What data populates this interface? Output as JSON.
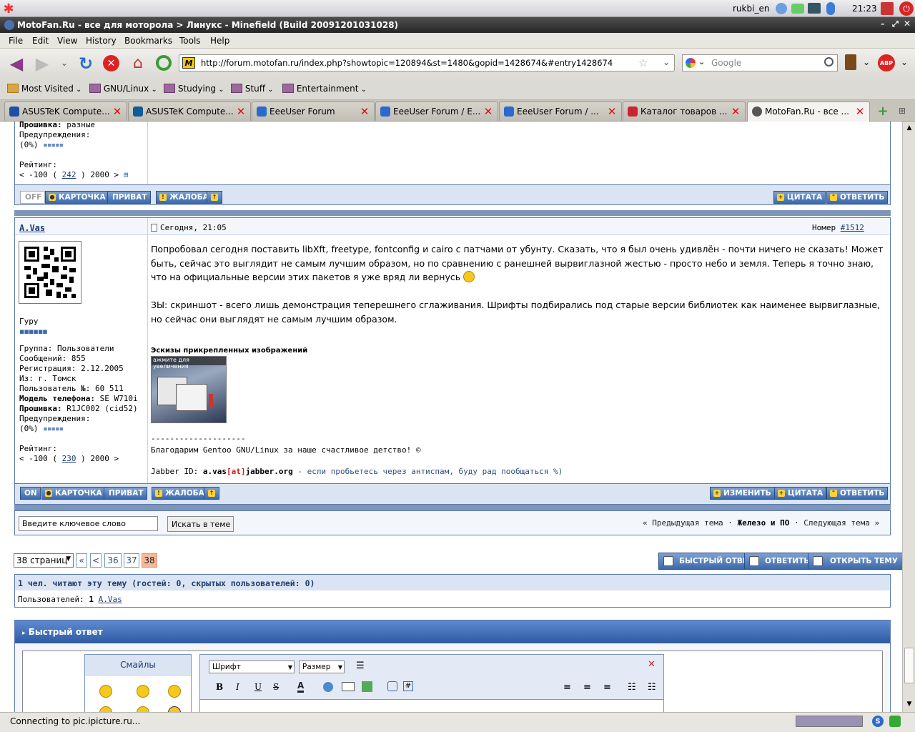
{
  "top_panel": {
    "user": "rukbi_en",
    "time": "21:23"
  },
  "window": {
    "title": "MotoFan.Ru - все для моторола > Линукс - Minefield (Build 20091201031028)"
  },
  "menu": [
    "File",
    "Edit",
    "View",
    "History",
    "Bookmarks",
    "Tools",
    "Help"
  ],
  "nav": {
    "url": "http://forum.motofan.ru/index.php?showtopic=120894&st=1480&gopid=1428674&#entry1428674",
    "search_placeholder": "Google"
  },
  "bookmarks": [
    "Most Visited",
    "GNU/Linux",
    "Studying",
    "Stuff",
    "Entertainment"
  ],
  "tabs": [
    {
      "label": "ASUSTeK Compute...",
      "color": "#1e4fa5"
    },
    {
      "label": "ASUSTeK Compute...",
      "color": "#0f5c99"
    },
    {
      "label": "EeeUser Forum",
      "color": "#2a6acd"
    },
    {
      "label": "EeeUser Forum / E...",
      "color": "#2a6acd"
    },
    {
      "label": "EeeUser Forum / ...",
      "color": "#2a6acd"
    },
    {
      "label": "Каталог товаров ...",
      "color": "#c23"
    },
    {
      "label": "MotoFan.Ru - все ...",
      "color": "#555"
    }
  ],
  "prev_post": {
    "firmware_label": "Прошивка:",
    "firmware_value": "разные",
    "warnings_label": "Предупреждения:",
    "warnings_value": "(0%)",
    "rating_label": "Рейтинг:",
    "rating_left": "< -100 (",
    "rating_num": "242",
    "rating_right": ") 2000 >",
    "buttons": {
      "off": "OFF",
      "card": "КАРТОЧКА",
      "pm": "ПРИВАТ",
      "report": "ЖАЛОБА",
      "quote": "ЦИТАТА",
      "reply": "ОТВЕТИТЬ"
    }
  },
  "post": {
    "author": "A.Vas",
    "date": "Сегодня, 21:05",
    "number_label": "Номер",
    "number": "#1512",
    "rank": "Гуру",
    "group": "Группа: Пользователи",
    "messages": "Сообщений: 855",
    "registered": "Регистрация: 2.12.2005",
    "from": "Из: г. Томск",
    "user_no": "Пользователь №: 60 511",
    "phone_label": "Модель телефона:",
    "phone_value": "SE W710i",
    "firmware_label": "Прошивка:",
    "firmware_value": "R1JC002 (cid52)",
    "warnings_label": "Предупреждения:",
    "warnings_value": "(0%)",
    "rating_label": "Рейтинг:",
    "rating_left": "< -100 (",
    "rating_num": "230",
    "rating_right": ") 2000 >",
    "text1": "Попробовал сегодня поставить libXft, freetype, fontconfig и cairo с патчами от убунту. Сказать, что я был очень удивлён - почти ничего не сказать! Может быть, сейчас это выглядит не самым лучшим образом, но по сравнению с ранешней вырвиглазной жестью - просто небо и земля. Теперь я точно знаю, что на официальные версии этих пакетов я уже вряд ли вернусь",
    "text2": "ЗЫ: скриншот - всего лишь демонстрация теперешнего сглаживания. Шрифты подбирались под старые версии библиотек как наименее вырвиглазные, но сейчас они выглядят не самым лучшим образом.",
    "attach_title": "Эскизы прикрепленных изображений",
    "thumb_caption": "ажмите для увеличения",
    "sig_line": "--------------------",
    "sig1": "Благодарим Gentoo GNU/Linux за наше счастливое детство! ©",
    "sig_jabber_label": "Jabber ID:",
    "sig_jabber_a": "a.vas",
    "sig_jabber_at": "[at]",
    "sig_jabber_b": "jabber.org",
    "sig_note": "- если пробьетесь через антиспам, буду рад пообщаться %)",
    "buttons": {
      "on": "ON",
      "card": "КАРТОЧКА",
      "pm": "ПРИВАТ",
      "report": "ЖАЛОБА",
      "edit": "ИЗМЕНИТЬ",
      "quote": "ЦИТАТА",
      "reply": "ОТВЕТИТЬ"
    }
  },
  "topic_search": {
    "placeholder": "Введите ключевое слово",
    "button": "Искать в теме"
  },
  "topic_nav": {
    "prev": "« Предыдущая тема",
    "sep": "·",
    "forum": "Железо и ПО",
    "next": "Следующая тема »"
  },
  "pagination": {
    "select": "38 страниц",
    "first": "«",
    "prev": "<",
    "pages": [
      "36",
      "37",
      "38"
    ],
    "current": "38"
  },
  "actions": {
    "fast_reply": "БЫСТРЫЙ ОТВЕТ",
    "reply": "ОТВЕТИТЬ",
    "new_topic": "ОТКРЫТЬ ТЕМУ"
  },
  "readers": {
    "title": "1 чел. читают эту тему (гостей: 0, скрытых пользователей: 0)",
    "users_label": "Пользователей:",
    "count": "1",
    "user": "A.Vas"
  },
  "quick_reply": {
    "title": "Быстрый ответ",
    "smiles": "Смайлы",
    "font": "Шрифт",
    "size": "Размер"
  },
  "status": {
    "text": "Connecting to pic.ipicture.ru..."
  }
}
